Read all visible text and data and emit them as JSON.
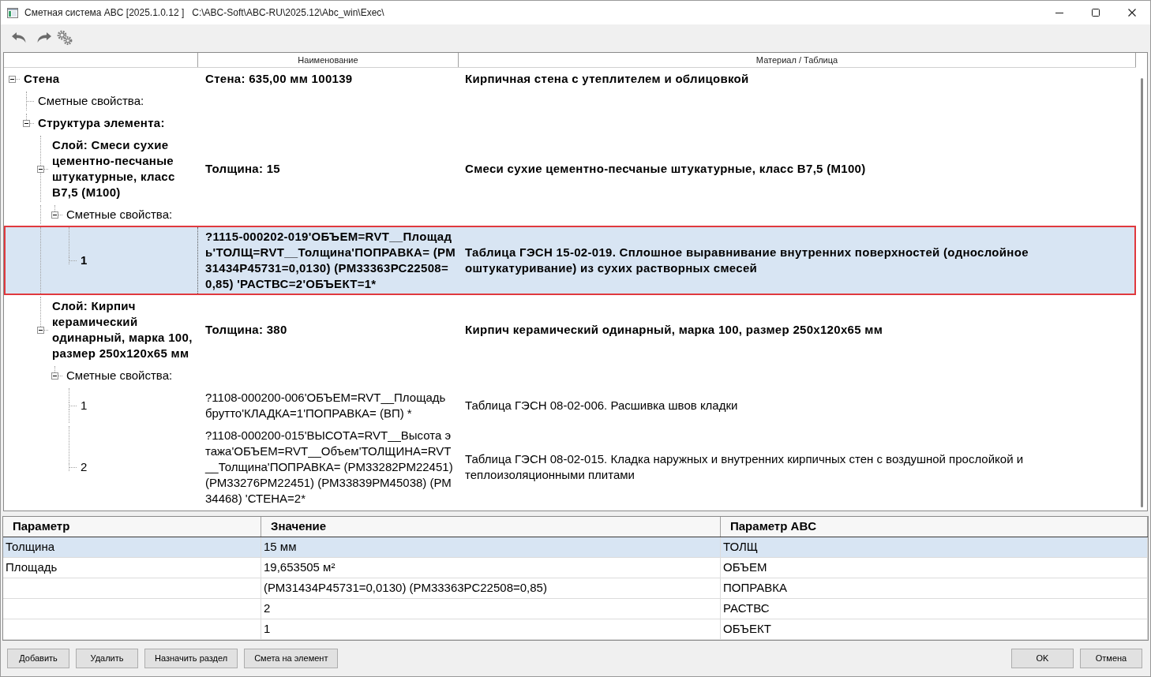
{
  "window": {
    "title": "Сметная система ABC [2025.1.0.12 ]   C:\\ABC-Soft\\ABC-RU\\2025.12\\Abc_win\\Exec\\"
  },
  "tree": {
    "headers": [
      "Наименование",
      "Материал / Таблица"
    ],
    "nodes": [
      {
        "label": "Стена",
        "name": "Стена: 635,00 мм 100139",
        "material": "Кирпичная стена с утеплителем и облицовкой",
        "bold": true,
        "selected": false,
        "expanded": true,
        "children": [
          {
            "label": "Сметные свойства:",
            "bold": false,
            "selected": false
          },
          {
            "label": "Структура элемента:",
            "bold": true,
            "selected": false,
            "expanded": true,
            "children": [
              {
                "label": "Слой: Смеси сухие цементно-песчаные штукатурные, класс В7,5 (М100)",
                "name": "Толщина: 15",
                "material": "Смеси сухие цементно-песчаные штукатурные, класс В7,5 (М100)",
                "bold": true,
                "selected": false,
                "expanded": true,
                "children": [
                  {
                    "label": "Сметные свойства:",
                    "bold": false,
                    "selected": false,
                    "expanded": true,
                    "children": [
                      {
                        "label": "1",
                        "name": "?1115-000202-019'ОБЪЕМ=RVT__Площадь'ТОЛЩ=RVT__Толщина'ПОПРАВКА= (РМ31434Р45731=0,0130) (РМ33363РС22508=0,85) 'РАСТВС=2'ОБЪЕКТ=1*",
                        "material": "Таблица ГЭСН 15-02-019. Сплошное выравнивание внутренних поверхностей (однослойное оштукатуривание) из сухих растворных смесей",
                        "bold": true,
                        "selected": true
                      }
                    ]
                  }
                ]
              },
              {
                "label": "Слой: Кирпич керамический одинарный, марка 100, размер 250х120х65 мм",
                "name": "Толщина: 380",
                "material": "Кирпич керамический одинарный, марка 100, размер 250х120х65 мм",
                "bold": true,
                "selected": false,
                "expanded": true,
                "children": [
                  {
                    "label": "Сметные свойства:",
                    "bold": false,
                    "selected": false,
                    "expanded": true,
                    "children": [
                      {
                        "label": "1",
                        "name": "?1108-000200-006'ОБЪЕМ=RVT__Площадь брутто'КЛАДКА=1'ПОПРАВКА= (ВП) *",
                        "material": "Таблица ГЭСН 08-02-006. Расшивка швов кладки",
                        "bold": false,
                        "selected": false
                      },
                      {
                        "label": "2",
                        "name": "?1108-000200-015'ВЫСОТА=RVT__Высота этажа'ОБЪЕМ=RVT__Объем'ТОЛЩИНА=RVT__Толщина'ПОПРАВКА= (РМ33282РМ22451) (РМ33276РМ22451) (РМ33839РМ45038) (РМ34468) 'СТЕНА=2*",
                        "material": "Таблица ГЭСН 08-02-015. Кладка наружных и внутренних кирпичных стен с воздушной прослойкой и теплоизоляционными плитами",
                        "bold": false,
                        "selected": false
                      }
                    ]
                  }
                ]
              }
            ]
          }
        ]
      }
    ]
  },
  "parameters_table": {
    "columns": [
      "Параметр",
      "Значение",
      "Параметр ABC"
    ],
    "rows": [
      {
        "parameter": "Толщина",
        "value": "15 мм",
        "abc_parameter": "ТОЛЩ",
        "selected": true
      },
      {
        "parameter": "Площадь",
        "value": "19,653505 м²",
        "abc_parameter": "ОБЪЕМ",
        "selected": false
      },
      {
        "value": "(РМ31434Р45731=0,0130) (РМ33363РС22508=0,85)",
        "abc_parameter": "ПОПРАВКА",
        "selected": false
      },
      {
        "value": "2",
        "abc_parameter": "РАСТВС",
        "selected": false
      },
      {
        "value": "1",
        "abc_parameter": "ОБЪЕКТ",
        "selected": false
      }
    ]
  },
  "buttons_left": [
    "Добавить",
    "Удалить",
    "Назначить раздел",
    "Смета на элемент"
  ],
  "buttons_right": [
    "OK",
    "Отмена"
  ]
}
